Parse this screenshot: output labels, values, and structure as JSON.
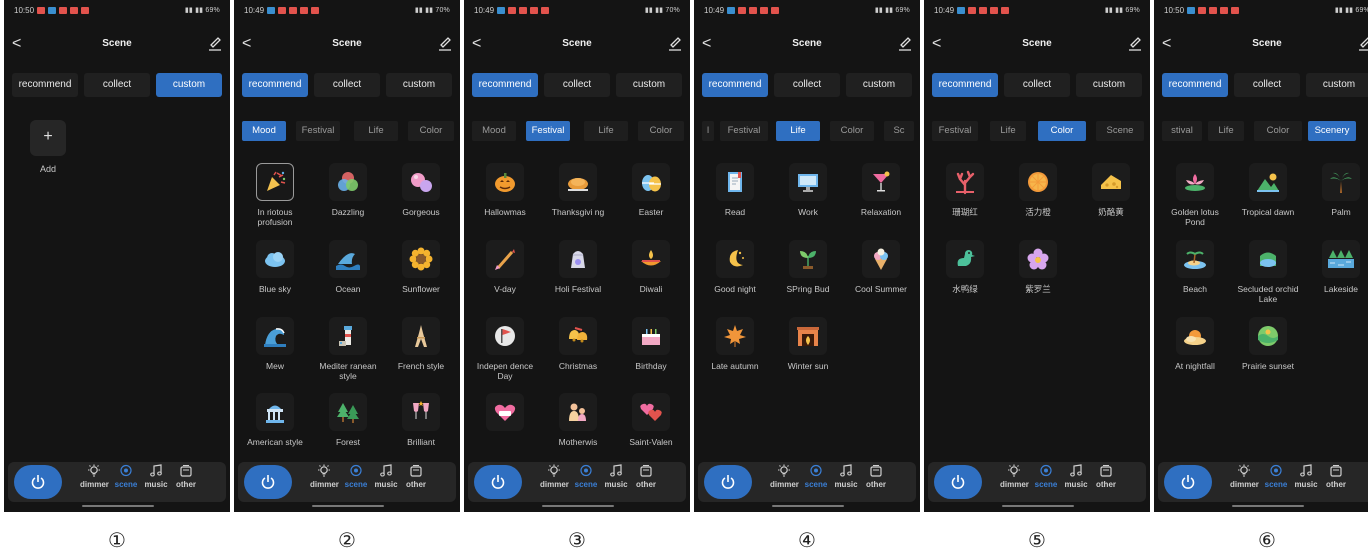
{
  "common": {
    "title": "Scene",
    "tabs": [
      "recommend",
      "collect",
      "custom"
    ],
    "nav": [
      "dimmer",
      "scene",
      "music",
      "other"
    ],
    "back_glyph": "<",
    "add_glyph": "+",
    "add_label": "Add",
    "active_color": "#2f6fc1"
  },
  "panels": [
    {
      "id": "1",
      "marker": "①",
      "time": "10:50",
      "battery": "69%",
      "active_tab": 2,
      "type": "custom",
      "status_icon_colors": [
        "#e2534d",
        "#3a8fd0",
        "#e2534d",
        "#e2534d",
        "#e2534d"
      ]
    },
    {
      "id": "2",
      "marker": "②",
      "time": "10:49",
      "battery": "70%",
      "active_tab": 0,
      "type": "grid",
      "subtabs": [
        "Mood",
        "Festival",
        "Life",
        "Color"
      ],
      "active_sub": 0,
      "status_icon_colors": [
        "#3a8fd0",
        "#e2534d",
        "#e2534d",
        "#e2534d",
        "#e2534d"
      ],
      "items": [
        {
          "label": "In riotous profusion",
          "icon": "party-popper",
          "selected": true
        },
        {
          "label": "Dazzling",
          "icon": "rgb-circles"
        },
        {
          "label": "Gorgeous",
          "icon": "bubbles"
        },
        {
          "label": "Blue sky",
          "icon": "cloud"
        },
        {
          "label": "Ocean",
          "icon": "shark-fin"
        },
        {
          "label": "Sunflower",
          "icon": "sunflower"
        },
        {
          "label": "Mew",
          "icon": "wave"
        },
        {
          "label": "Mediter ranean style",
          "icon": "lighthouse"
        },
        {
          "label": "French style",
          "icon": "eiffel-tower"
        },
        {
          "label": "American style",
          "icon": "capitol"
        },
        {
          "label": "Forest",
          "icon": "trees"
        },
        {
          "label": "Brilliant",
          "icon": "cheers"
        }
      ]
    },
    {
      "id": "3",
      "marker": "③",
      "time": "10:49",
      "battery": "70%",
      "active_tab": 0,
      "type": "grid",
      "subtabs": [
        "Mood",
        "Festival",
        "Life",
        "Color"
      ],
      "active_sub": 1,
      "status_icon_colors": [
        "#3a8fd0",
        "#e2534d",
        "#e2534d",
        "#e2534d",
        "#e2534d"
      ],
      "items": [
        {
          "label": "Hallowmas",
          "icon": "pumpkin"
        },
        {
          "label": "Thanksgivi ng",
          "icon": "turkey"
        },
        {
          "label": "Easter",
          "icon": "easter-eggs"
        },
        {
          "label": "V-day",
          "icon": "cupid-arrow"
        },
        {
          "label": "Holi Festival",
          "icon": "holi-bag"
        },
        {
          "label": "Diwali",
          "icon": "diya-lamp"
        },
        {
          "label": "Indepen dence Day",
          "icon": "flag"
        },
        {
          "label": "Christmas",
          "icon": "bells"
        },
        {
          "label": "Birthday",
          "icon": "cake"
        },
        {
          "label": "",
          "icon": "love-heart"
        },
        {
          "label": "Motherwis",
          "icon": "mother-child"
        },
        {
          "label": "Saint-Valen",
          "icon": "hearts"
        }
      ]
    },
    {
      "id": "4",
      "marker": "④",
      "time": "10:49",
      "battery": "69%",
      "active_tab": 0,
      "type": "grid",
      "subtabs": [
        "l",
        "Festival",
        "Life",
        "Color",
        "Sc"
      ],
      "active_sub": 2,
      "status_icon_colors": [
        "#3a8fd0",
        "#e2534d",
        "#e2534d",
        "#e2534d",
        "#e2534d"
      ],
      "items": [
        {
          "label": "Read",
          "icon": "book"
        },
        {
          "label": "Work",
          "icon": "monitor"
        },
        {
          "label": "Relaxation",
          "icon": "cocktail"
        },
        {
          "label": "Good night",
          "icon": "moon"
        },
        {
          "label": "SPring Bud",
          "icon": "sprout"
        },
        {
          "label": "Cool Summer",
          "icon": "ice-cream"
        },
        {
          "label": "Late autumn",
          "icon": "maple-leaf"
        },
        {
          "label": "Winter sun",
          "icon": "fireplace"
        }
      ]
    },
    {
      "id": "5",
      "marker": "⑤",
      "time": "10:49",
      "battery": "69%",
      "active_tab": 0,
      "type": "grid",
      "subtabs": [
        "Festival",
        "Life",
        "Color",
        "Scene"
      ],
      "active_sub": 2,
      "status_icon_colors": [
        "#3a8fd0",
        "#e2534d",
        "#e2534d",
        "#e2534d",
        "#e2534d"
      ],
      "items": [
        {
          "label": "珊瑚红",
          "icon": "coral"
        },
        {
          "label": "活力橙",
          "icon": "orange-slice"
        },
        {
          "label": "奶酪黄",
          "icon": "cheese"
        },
        {
          "label": "水鸭绿",
          "icon": "duck"
        },
        {
          "label": "紫罗兰",
          "icon": "violet-flower"
        }
      ]
    },
    {
      "id": "6",
      "marker": "⑥",
      "time": "10:50",
      "battery": "69%",
      "active_tab": 0,
      "type": "grid",
      "subtabs": [
        "stival",
        "Life",
        "Color",
        "Scenery"
      ],
      "active_sub": 3,
      "status_icon_colors": [
        "#3a8fd0",
        "#e2534d",
        "#e2534d",
        "#e2534d",
        "#e2534d"
      ],
      "items": [
        {
          "label": "Golden lotus Pond",
          "icon": "lotus"
        },
        {
          "label": "Tropical dawn",
          "icon": "mountain-sun"
        },
        {
          "label": "Palm",
          "icon": "palm-tree"
        },
        {
          "label": "Beach",
          "icon": "beach-island"
        },
        {
          "label": "Secluded orchid Lake",
          "icon": "lake"
        },
        {
          "label": "Lakeside",
          "icon": "lakeside-trees"
        },
        {
          "label": "At nightfall",
          "icon": "sunset-cloud"
        },
        {
          "label": "Prairie sunset",
          "icon": "prairie-globe"
        }
      ]
    }
  ]
}
